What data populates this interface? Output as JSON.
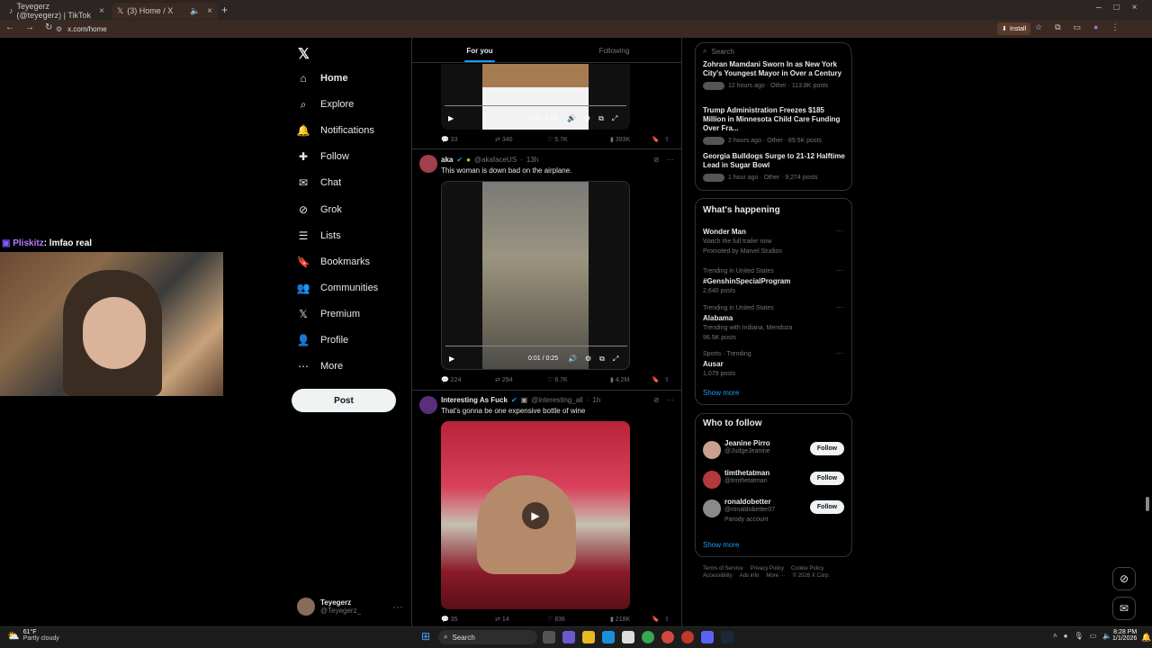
{
  "browser": {
    "tabs": [
      {
        "label": "Teyegerz (@teyegerz) | TikTok",
        "icon": "tiktok-icon"
      },
      {
        "label": "(3) Home / X",
        "icon": "x-logo-icon"
      }
    ],
    "url": "x.com/home",
    "install_label": "Install"
  },
  "nav": {
    "items": [
      {
        "label": "Home",
        "icon": "home-icon"
      },
      {
        "label": "Explore",
        "icon": "search-icon"
      },
      {
        "label": "Notifications",
        "icon": "bell-icon"
      },
      {
        "label": "Follow",
        "icon": "person-add-icon"
      },
      {
        "label": "Chat",
        "icon": "mail-icon"
      },
      {
        "label": "Grok",
        "icon": "grok-icon"
      },
      {
        "label": "Lists",
        "icon": "list-icon"
      },
      {
        "label": "Bookmarks",
        "icon": "bookmark-icon"
      },
      {
        "label": "Communities",
        "icon": "communities-icon"
      },
      {
        "label": "Premium",
        "icon": "x-logo-icon"
      },
      {
        "label": "Profile",
        "icon": "person-icon"
      },
      {
        "label": "More",
        "icon": "more-circle-icon"
      }
    ],
    "post_label": "Post",
    "account": {
      "name": "Teyegerz",
      "handle": "@Teyegerz_"
    }
  },
  "stream_overlay": {
    "user": "Pliskitz",
    "message": ": lmfao real"
  },
  "timeline": {
    "tabs": [
      "For you",
      "Following"
    ],
    "tweets": [
      {
        "video": {
          "time": "0:15 / 0:24"
        },
        "stats": {
          "replies": "33",
          "reposts": "340",
          "likes": "5.7K",
          "views": "393K"
        }
      },
      {
        "name": "aka",
        "handle": "@akafaceUS",
        "time": "13h",
        "text": "This woman is down bad on the airplane.",
        "video": {
          "time": "0:01 / 0:25"
        },
        "stats": {
          "replies": "224",
          "reposts": "294",
          "likes": "9.7K",
          "views": "4.2M"
        }
      },
      {
        "name": "Interesting As Fuck",
        "handle": "@interesting_all",
        "time": "1h",
        "text": "That's gonna be one expensive bottle of wine",
        "stats": {
          "replies": "35",
          "reposts": "14",
          "likes": "836",
          "views": "218K"
        }
      }
    ]
  },
  "search": {
    "placeholder": "Search"
  },
  "news": [
    {
      "title": "Zohran Mamdani Sworn In as New York City's Youngest Mayor in Over a Century",
      "meta": "12 hours ago · Other · 113.8K posts"
    },
    {
      "title": "Trump Administration Freezes $185 Million in Minnesota Child Care Funding Over Fra...",
      "meta": "2 hours ago · Other · 89.5K posts"
    },
    {
      "title": "Georgia Bulldogs Surge to 21-12 Halftime Lead in Sugar Bowl",
      "meta": "1 hour ago · Other · 9,274 posts"
    }
  ],
  "whats_happening": {
    "title": "What's happening",
    "items": [
      {
        "category": "",
        "title": "Wonder Man",
        "sub": "Watch the full trailer now",
        "extra": "Promoted by Marvel Studios"
      },
      {
        "category": "Trending in United States",
        "title": "#GenshinSpecialProgram",
        "sub": "",
        "extra": "2,640 posts"
      },
      {
        "category": "Trending in United States",
        "title": "Alabama",
        "sub": "Trending with Indiana, Mendoza",
        "extra": "96.5K posts"
      },
      {
        "category": "Sports · Trending",
        "title": "Ausar",
        "sub": "",
        "extra": "1,079 posts"
      }
    ],
    "show_more": "Show more"
  },
  "who_to_follow": {
    "title": "Who to follow",
    "users": [
      {
        "name": "Jeanine Pirro",
        "handle": "@JudgeJeanine",
        "note": ""
      },
      {
        "name": "timthetatman",
        "handle": "@timthetatman",
        "note": ""
      },
      {
        "name": "ronaldobetter",
        "handle": "@ronaldobetter07",
        "note": "Parody account"
      }
    ],
    "follow_label": "Follow",
    "show_more": "Show more"
  },
  "footer_links": [
    "Terms of Service",
    "Privacy Policy",
    "Cookie Policy",
    "Accessibility",
    "Ads info",
    "More ···",
    "© 2026 X Corp."
  ],
  "taskbar": {
    "weather_temp": "61°F",
    "weather_desc": "Partly cloudy",
    "search_label": "Search",
    "time": "8:28 PM",
    "date": "1/1/2026"
  },
  "colors": {
    "accent": "#1d9bf0",
    "background": "#000000",
    "chrome": "#3a2a24"
  }
}
